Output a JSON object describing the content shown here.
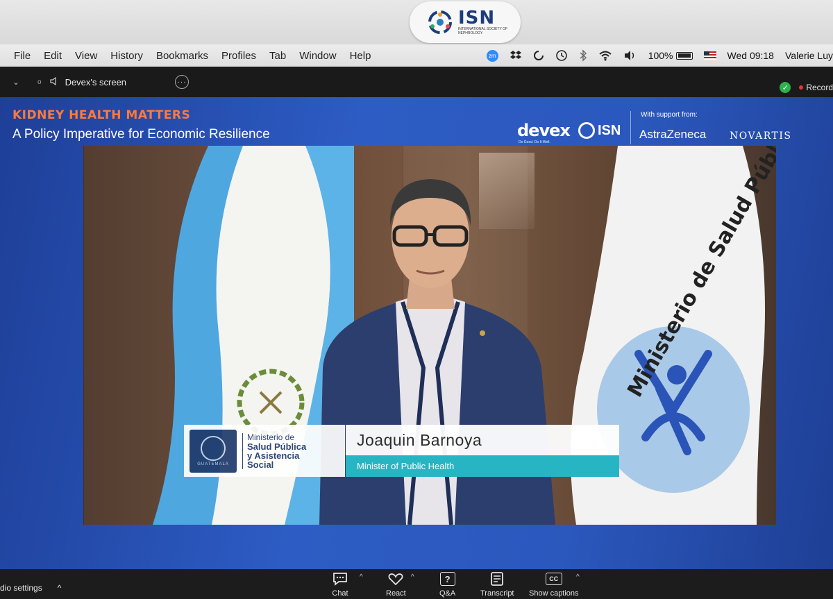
{
  "sticker": {
    "big": "ISN",
    "small": "International Society of Nephrology"
  },
  "menubar": {
    "items": [
      "File",
      "Edit",
      "View",
      "History",
      "Bookmarks",
      "Profiles",
      "Tab",
      "Window",
      "Help"
    ],
    "zoom_badge": "zm",
    "battery": "100%",
    "datetime": "Wed 09:18",
    "user": "Valerie Luy"
  },
  "zoom_header": {
    "dot": "o",
    "title": "Devex's screen",
    "more": "···",
    "recording": "Record"
  },
  "slide": {
    "title": "KIDNEY HEALTH MATTERS",
    "subtitle": "A Policy Imperative for Economic Resilience",
    "sponsors": {
      "devex": "devex",
      "devex_tag": "Do Good. Do It Well.",
      "isn": "ISN",
      "support": "With support from:",
      "astrazeneca": "AstraZeneca",
      "novartis": "NOVARTIS"
    }
  },
  "video": {
    "ministry_logo_line1": "Ministerio de",
    "ministry_logo_line2": "Salud Pública",
    "ministry_logo_line3": "y Asistencia",
    "ministry_logo_line4": "Social",
    "seal_label": "GUATEMALA",
    "speaker_name": "Joaquin Barnoya",
    "speaker_role": "Minister of Public Health",
    "flag_text": "Ministerio de Salud Pública"
  },
  "footer": {
    "audio": "dio settings",
    "tools": [
      {
        "label": "Chat"
      },
      {
        "label": "React"
      },
      {
        "label": "Q&A"
      },
      {
        "label": "Transcript"
      },
      {
        "label": "Show captions"
      }
    ],
    "qa_glyph": "?",
    "cc_glyph": "CC"
  },
  "colors": {
    "slide_accent": "#ff7a3c",
    "slide_bg": "#2d5cc4",
    "role_bar": "#27b5c3",
    "zoom_dark": "#1a1a1a"
  }
}
